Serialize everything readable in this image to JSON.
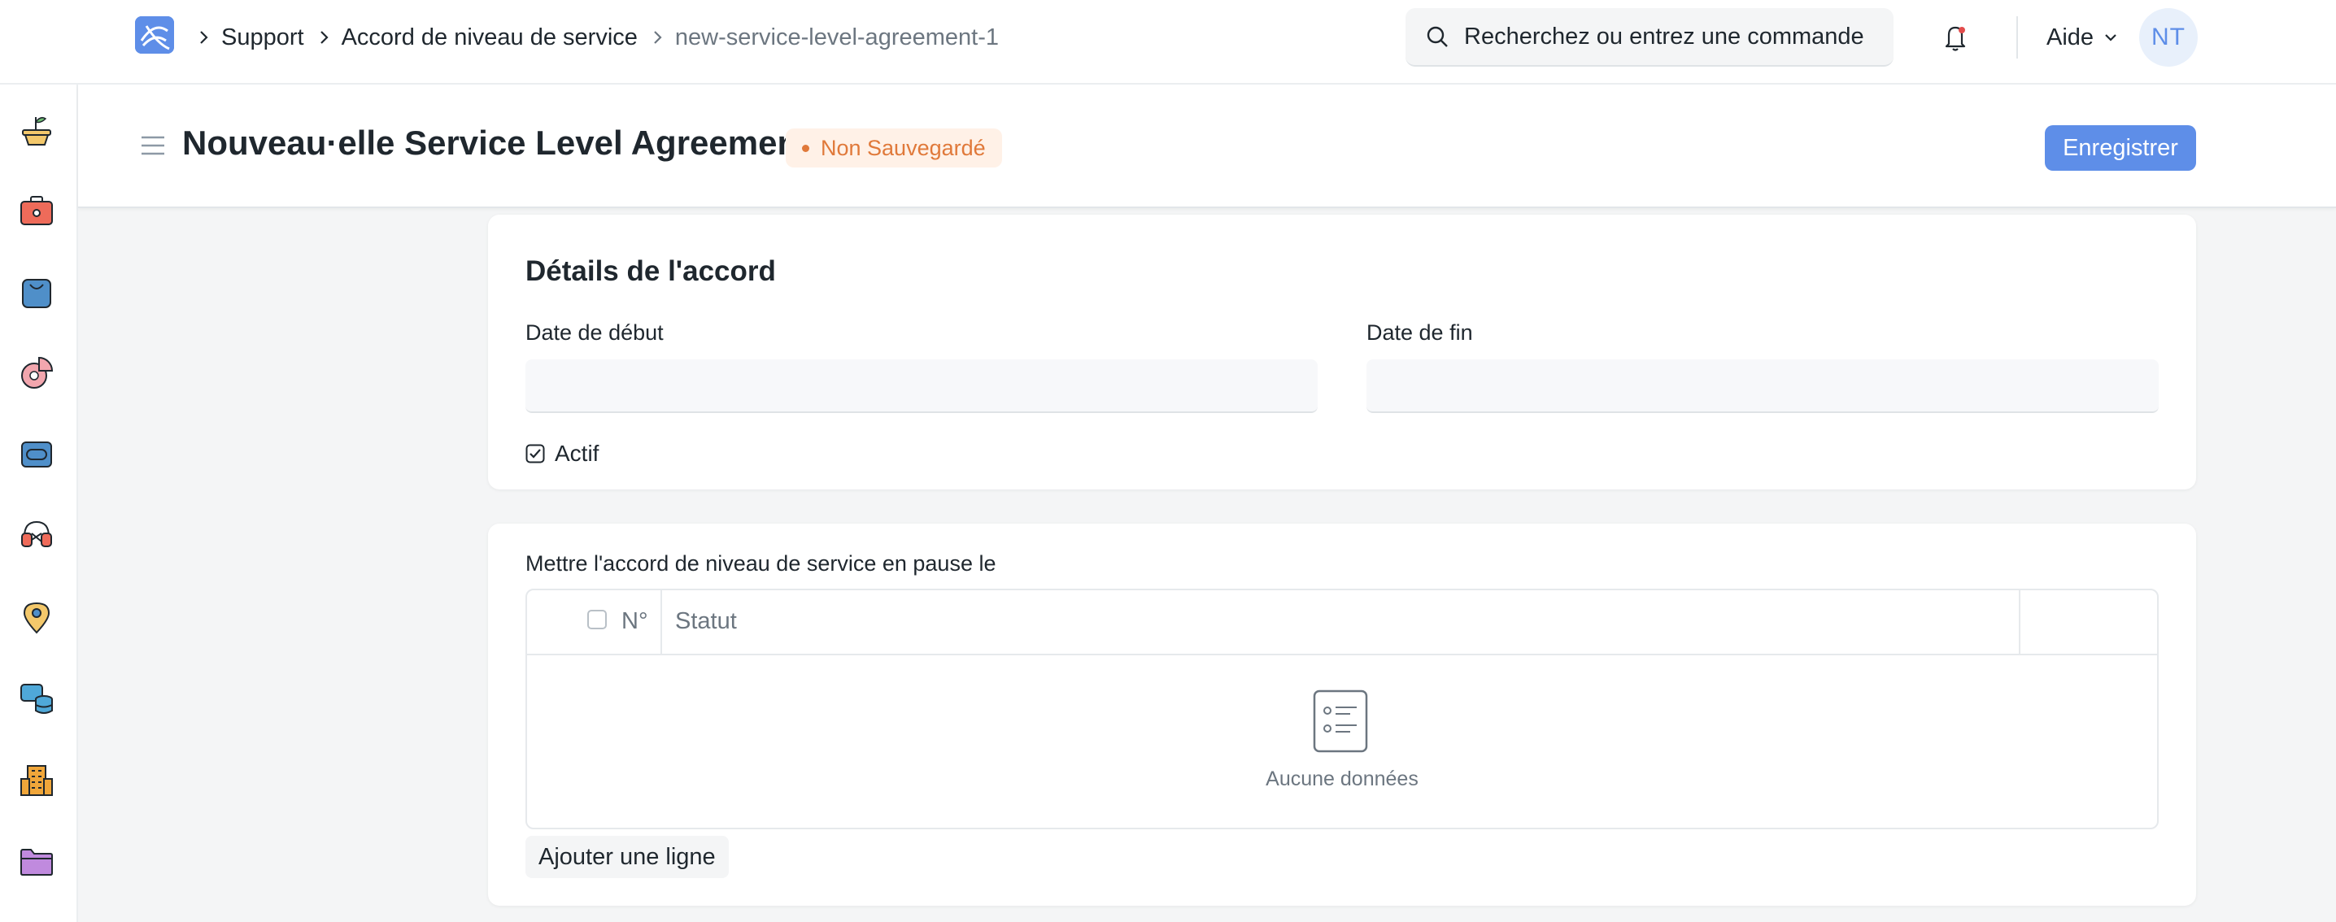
{
  "navbar": {
    "breadcrumbs": [
      "Support",
      "Accord de niveau de service",
      "new-service-level-agreement-1"
    ],
    "search_placeholder": "Recherchez ou entrez une commande",
    "help_label": "Aide",
    "avatar_initials": "NT"
  },
  "sidebar": {
    "icons": [
      "plant-pot-icon",
      "toolbox-icon",
      "shopping-bag-icon",
      "pie-chart-icon",
      "ticket-icon",
      "headset-icon",
      "map-pin-icon",
      "chat-database-icon",
      "building-icon",
      "folder-icon"
    ]
  },
  "page": {
    "title": "Nouveau·elle Service Level Agreement",
    "status": "Non Sauvegardé",
    "save_label": "Enregistrer"
  },
  "agreement_details": {
    "title": "Détails de l'accord",
    "start_date_label": "Date de début",
    "start_date_value": "",
    "end_date_label": "Date de fin",
    "end_date_value": "",
    "active_label": "Actif",
    "active_checked": true
  },
  "pause_table": {
    "label": "Mettre l'accord de niveau de service en pause le",
    "columns": [
      "N°",
      "Statut"
    ],
    "rows": [],
    "empty_text": "Aucune données",
    "add_row_label": "Ajouter une ligne"
  },
  "colors": {
    "primary": "#5e8ee8",
    "status_text": "#e0793a",
    "status_bg": "#fff1e7"
  }
}
